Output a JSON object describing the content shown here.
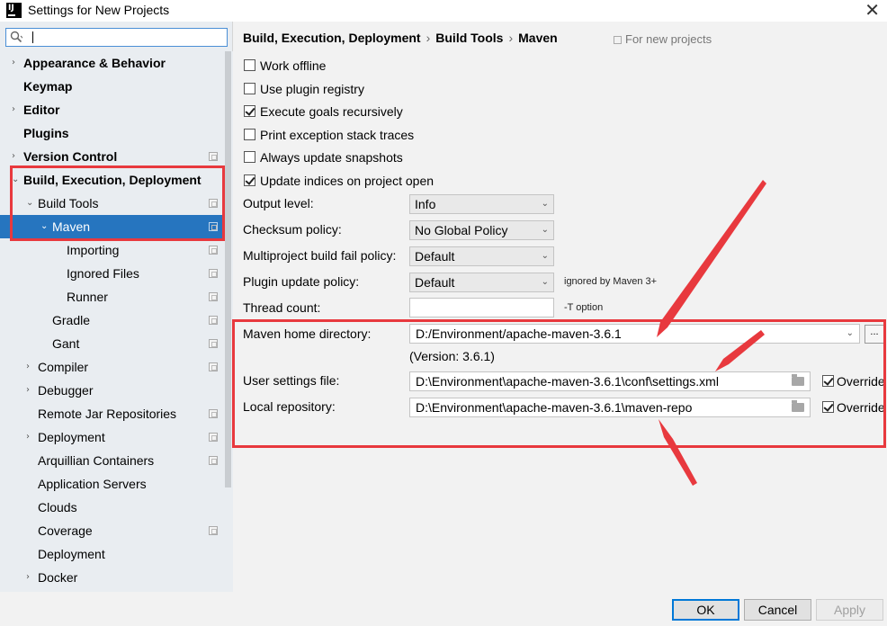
{
  "window": {
    "title": "Settings for New Projects",
    "close_glyph": "✕",
    "app_icon_text": "IJ"
  },
  "search": {
    "value": "",
    "icon": "search-icon"
  },
  "tree": [
    {
      "label": "Appearance & Behavior",
      "bold": true,
      "arrow": "›"
    },
    {
      "label": "Keymap",
      "bold": true,
      "arrow": ""
    },
    {
      "label": "Editor",
      "bold": true,
      "arrow": "›"
    },
    {
      "label": "Plugins",
      "bold": true,
      "arrow": ""
    },
    {
      "label": "Version Control",
      "bold": true,
      "arrow": "›"
    },
    {
      "label": "Build, Execution, Deployment",
      "bold": true,
      "arrow": "⌄"
    },
    {
      "label": "Build Tools",
      "bold": false,
      "arrow": "⌄"
    },
    {
      "label": "Maven",
      "bold": false,
      "arrow": "⌄"
    },
    {
      "label": "Importing",
      "bold": false,
      "arrow": ""
    },
    {
      "label": "Ignored Files",
      "bold": false,
      "arrow": ""
    },
    {
      "label": "Runner",
      "bold": false,
      "arrow": ""
    },
    {
      "label": "Gradle",
      "bold": false,
      "arrow": ""
    },
    {
      "label": "Gant",
      "bold": false,
      "arrow": ""
    },
    {
      "label": "Compiler",
      "bold": false,
      "arrow": "›"
    },
    {
      "label": "Debugger",
      "bold": false,
      "arrow": "›"
    },
    {
      "label": "Remote Jar Repositories",
      "bold": false,
      "arrow": ""
    },
    {
      "label": "Deployment",
      "bold": false,
      "arrow": "›"
    },
    {
      "label": "Arquillian Containers",
      "bold": false,
      "arrow": ""
    },
    {
      "label": "Application Servers",
      "bold": false,
      "arrow": ""
    },
    {
      "label": "Clouds",
      "bold": false,
      "arrow": ""
    },
    {
      "label": "Coverage",
      "bold": false,
      "arrow": ""
    },
    {
      "label": "Deployment",
      "bold": false,
      "arrow": ""
    },
    {
      "label": "Docker",
      "bold": false,
      "arrow": "›"
    }
  ],
  "breadcrumb": {
    "part1": "Build, Execution, Deployment",
    "part2": "Build Tools",
    "part3": "Maven",
    "separator": "›"
  },
  "for_new_projects": "For new projects",
  "checkboxes": [
    {
      "label": "Work offline",
      "checked": false
    },
    {
      "label": "Use plugin registry",
      "checked": false
    },
    {
      "label": "Execute goals recursively",
      "checked": true
    },
    {
      "label": "Print exception stack traces",
      "checked": false
    },
    {
      "label": "Always update snapshots",
      "checked": false
    },
    {
      "label": "Update indices on project open",
      "checked": true
    }
  ],
  "fields": {
    "output_level": {
      "label": "Output level:",
      "value": "Info"
    },
    "checksum_policy": {
      "label": "Checksum policy:",
      "value": "No Global Policy"
    },
    "multiproject_fail": {
      "label": "Multiproject build fail policy:",
      "value": "Default"
    },
    "plugin_update": {
      "label": "Plugin update policy:",
      "value": "Default",
      "hint": "ignored by Maven 3+"
    },
    "thread_count": {
      "label": "Thread count:",
      "value": "",
      "hint": "-T option"
    },
    "maven_home": {
      "label": "Maven home directory:",
      "value": "D:/Environment/apache-maven-3.6.1",
      "browse": "..."
    },
    "version": "(Version: 3.6.1)",
    "user_settings": {
      "label": "User settings file:",
      "value": "D:\\Environment\\apache-maven-3.6.1\\conf\\settings.xml",
      "override": "Override",
      "override_checked": true
    },
    "local_repo": {
      "label": "Local repository:",
      "value": "D:\\Environment\\apache-maven-3.6.1\\maven-repo",
      "override": "Override",
      "override_checked": true
    }
  },
  "buttons": {
    "ok": "OK",
    "cancel": "Cancel",
    "apply": "Apply",
    "help": "?"
  },
  "annotation_color": "#e8393e",
  "selection_color": "#2675bf"
}
